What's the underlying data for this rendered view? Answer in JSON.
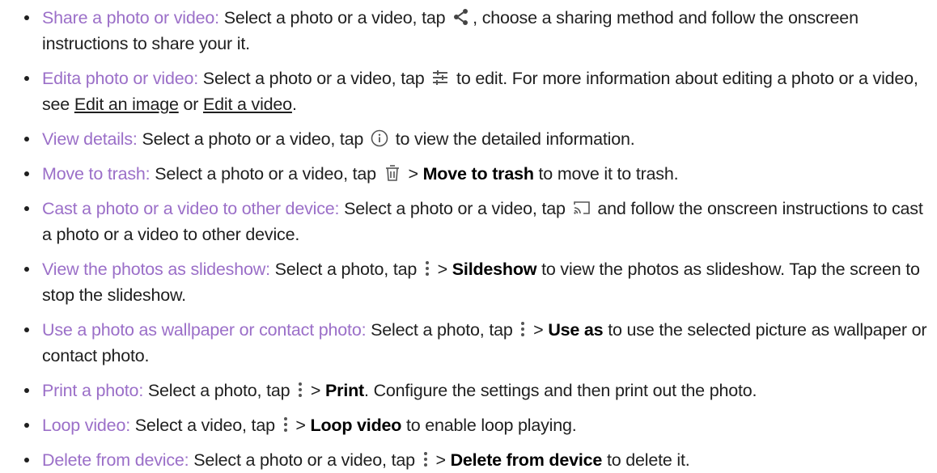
{
  "accent_color": "#9b6fc8",
  "icons": {
    "share": "share-icon",
    "edit": "sliders-icon",
    "info": "info-icon",
    "trash": "trash-icon",
    "cast": "cast-icon",
    "more": "more-vertical-icon"
  },
  "items": [
    {
      "lead": "Share a photo or video:",
      "t1": " Select a photo or a video, tap ",
      "t2": ", choose a sharing method and follow the onscreen instructions to share your it."
    },
    {
      "lead": "Edita photo or video:",
      "t1": " Select a photo or a video, tap ",
      "t2": " to edit. For more information about editing a photo or a video, see ",
      "link1": "Edit an image",
      "t3": " or ",
      "link2": "Edit a video",
      "t4": "."
    },
    {
      "lead": "View details:",
      "t1": " Select a photo or a video, tap ",
      "t2": " to view the detailed information."
    },
    {
      "lead": "Move to trash:",
      "t1": " Select a photo or a video, tap ",
      "t2": " > ",
      "bold": "Move to trash",
      "t3": " to move it to trash."
    },
    {
      "lead": "Cast a photo or a video to other device:",
      "t1": " Select a photo or a video, tap ",
      "t2": " and follow the onscreen instructions to cast a photo or a video to other device."
    },
    {
      "lead": "View the photos as slideshow:",
      "t1": " Select a photo, tap ",
      "t2": " > ",
      "bold": "Sildeshow",
      "t3": " to view the photos as slideshow. Tap the screen to stop the slideshow."
    },
    {
      "lead": "Use a photo as wallpaper or contact photo:",
      "t1": " Select a photo, tap ",
      "t2": " > ",
      "bold": "Use as",
      "t3": " to use the selected picture as wallpaper or contact photo."
    },
    {
      "lead": "Print a photo:",
      "t1": " Select a photo, tap ",
      "t2": " > ",
      "bold": "Print",
      "t3": ". Configure the settings and then print out the photo."
    },
    {
      "lead": "Loop video:",
      "t1": " Select a video, tap ",
      "t2": " > ",
      "bold": "Loop video",
      "t3": " to enable loop playing."
    },
    {
      "lead": "Delete from device:",
      "t1": " Select a photo or a video, tap ",
      "t2": " > ",
      "bold": "Delete from device",
      "t3": " to delete it."
    }
  ]
}
